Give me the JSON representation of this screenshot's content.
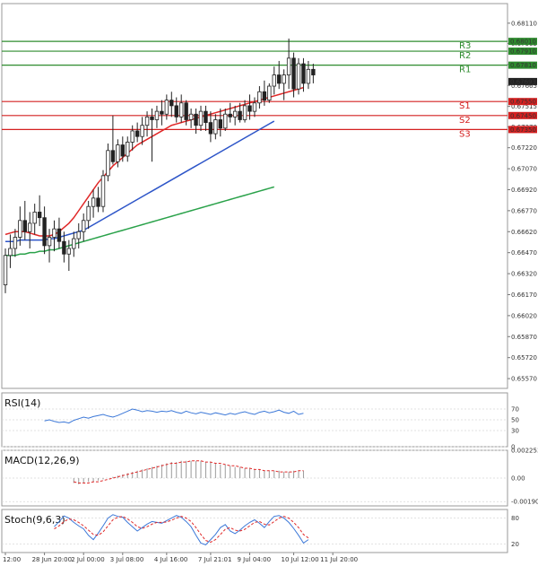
{
  "chart_data": {
    "type": "candlestick",
    "price_axis": {
      "min": 0.655,
      "max": 0.6825,
      "ticks": [
        "0.68110",
        "0.67965",
        "0.67815",
        "0.67665",
        "0.67515",
        "0.67370",
        "0.67220",
        "0.67070",
        "0.66920",
        "0.66770",
        "0.66620",
        "0.66470",
        "0.66320",
        "0.66170",
        "0.66020",
        "0.65870",
        "0.65720",
        "0.65570"
      ],
      "ticks_num": [
        0.6811,
        0.67965,
        0.67815,
        0.67665,
        0.67515,
        0.6737,
        0.6722,
        0.6707,
        0.6692,
        0.6677,
        0.6662,
        0.6647,
        0.6632,
        0.6617,
        0.6602,
        0.6587,
        0.6572,
        0.6557
      ]
    },
    "time_axis": {
      "labels": [
        "12:00",
        "28 Jun 20:00",
        "2 Jul 00:00",
        "3 Jul 08:00",
        "4 Jul 16:00",
        "7 Jul 21:01",
        "9 Jul 04:00",
        "10 Jul 12:00",
        "11 Jul 20:00"
      ],
      "label_bars": [
        0,
        8,
        16,
        24,
        33,
        42,
        50,
        59,
        67
      ]
    },
    "levels": [
      {
        "name": "R3",
        "value": 0.6798,
        "price_label": "0.68010",
        "color": "#2e8b2e"
      },
      {
        "name": "R2",
        "value": 0.6791,
        "price_label": "0.67910",
        "color": "#2e8b2e"
      },
      {
        "name": "R1",
        "value": 0.6781,
        "price_label": "0.67810",
        "color": "#2e8b2e"
      },
      {
        "name": "S1",
        "value": 0.6755,
        "price_label": "0.67550",
        "color": "#d42020"
      },
      {
        "name": "S2",
        "value": 0.6745,
        "price_label": "0.67450",
        "color": "#d42020"
      },
      {
        "name": "S3",
        "value": 0.6735,
        "price_label": "0.67350",
        "color": "#d42020"
      }
    ],
    "current_price": {
      "price_label": "0.67693",
      "value": 0.67693
    },
    "candles": [
      [
        0.6624,
        0.665,
        0.6618,
        0.6645
      ],
      [
        0.6645,
        0.666,
        0.6636,
        0.665
      ],
      [
        0.665,
        0.6664,
        0.6644,
        0.6658
      ],
      [
        0.6658,
        0.668,
        0.6652,
        0.667
      ],
      [
        0.667,
        0.6684,
        0.6656,
        0.6662
      ],
      [
        0.6662,
        0.6676,
        0.665,
        0.6668
      ],
      [
        0.6668,
        0.6682,
        0.666,
        0.6676
      ],
      [
        0.6676,
        0.6688,
        0.6666,
        0.6672
      ],
      [
        0.6672,
        0.668,
        0.6646,
        0.6652
      ],
      [
        0.6652,
        0.6664,
        0.664,
        0.6658
      ],
      [
        0.6658,
        0.667,
        0.6648,
        0.6664
      ],
      [
        0.6664,
        0.6672,
        0.665,
        0.6655
      ],
      [
        0.6655,
        0.6662,
        0.664,
        0.6646
      ],
      [
        0.6646,
        0.6656,
        0.6634,
        0.665
      ],
      [
        0.665,
        0.6662,
        0.6644,
        0.6657
      ],
      [
        0.6657,
        0.6668,
        0.665,
        0.6662
      ],
      [
        0.6662,
        0.6675,
        0.6655,
        0.667
      ],
      [
        0.667,
        0.6684,
        0.6664,
        0.668
      ],
      [
        0.668,
        0.6692,
        0.6672,
        0.6686
      ],
      [
        0.6686,
        0.6694,
        0.6676,
        0.668
      ],
      [
        0.668,
        0.6706,
        0.6676,
        0.6702
      ],
      [
        0.6702,
        0.6725,
        0.6698,
        0.672
      ],
      [
        0.672,
        0.6745,
        0.671,
        0.6712
      ],
      [
        0.6712,
        0.6728,
        0.6708,
        0.6724
      ],
      [
        0.6724,
        0.673,
        0.6712,
        0.6716
      ],
      [
        0.6716,
        0.673,
        0.6712,
        0.6726
      ],
      [
        0.6726,
        0.6738,
        0.672,
        0.6734
      ],
      [
        0.6734,
        0.674,
        0.6726,
        0.673
      ],
      [
        0.673,
        0.6744,
        0.6724,
        0.6738
      ],
      [
        0.6738,
        0.6748,
        0.673,
        0.6744
      ],
      [
        0.6744,
        0.675,
        0.6712,
        0.6742
      ],
      [
        0.6742,
        0.6752,
        0.6736,
        0.6748
      ],
      [
        0.6748,
        0.6756,
        0.6738,
        0.6746
      ],
      [
        0.6746,
        0.676,
        0.6742,
        0.6756
      ],
      [
        0.6756,
        0.6762,
        0.6744,
        0.6752
      ],
      [
        0.6752,
        0.6758,
        0.674,
        0.6744
      ],
      [
        0.6744,
        0.676,
        0.674,
        0.6754
      ],
      [
        0.6754,
        0.6756,
        0.6738,
        0.6742
      ],
      [
        0.6742,
        0.675,
        0.6736,
        0.6746
      ],
      [
        0.6746,
        0.675,
        0.6732,
        0.6738
      ],
      [
        0.6738,
        0.6752,
        0.6734,
        0.6748
      ],
      [
        0.6748,
        0.6752,
        0.6734,
        0.674
      ],
      [
        0.674,
        0.6748,
        0.6726,
        0.6732
      ],
      [
        0.6732,
        0.6746,
        0.6728,
        0.6742
      ],
      [
        0.6742,
        0.675,
        0.673,
        0.6736
      ],
      [
        0.6736,
        0.675,
        0.6734,
        0.6746
      ],
      [
        0.6746,
        0.6754,
        0.674,
        0.6744
      ],
      [
        0.6744,
        0.6752,
        0.6738,
        0.6748
      ],
      [
        0.6748,
        0.6754,
        0.674,
        0.6742
      ],
      [
        0.6742,
        0.6756,
        0.674,
        0.6752
      ],
      [
        0.6752,
        0.676,
        0.6742,
        0.6748
      ],
      [
        0.6748,
        0.6758,
        0.6744,
        0.6754
      ],
      [
        0.6754,
        0.6766,
        0.675,
        0.6762
      ],
      [
        0.6762,
        0.677,
        0.6752,
        0.6756
      ],
      [
        0.6756,
        0.6768,
        0.6754,
        0.6766
      ],
      [
        0.6766,
        0.678,
        0.676,
        0.6774
      ],
      [
        0.6774,
        0.6784,
        0.6764,
        0.6768
      ],
      [
        0.6768,
        0.6778,
        0.6756,
        0.6774
      ],
      [
        0.6774,
        0.68,
        0.6764,
        0.6786
      ],
      [
        0.6786,
        0.679,
        0.6758,
        0.6764
      ],
      [
        0.6764,
        0.6786,
        0.676,
        0.6782
      ],
      [
        0.6782,
        0.6786,
        0.6762,
        0.6768
      ],
      [
        0.6768,
        0.6784,
        0.6764,
        0.6778
      ],
      [
        0.6778,
        0.6782,
        0.6768,
        0.6774
      ]
    ],
    "ma_red": [
      0.666,
      0.6661,
      0.6662,
      0.6662,
      0.6662,
      0.6661,
      0.666,
      0.6659,
      0.6659,
      0.6659,
      0.666,
      0.6662,
      0.6665,
      0.6668,
      0.6672,
      0.6677,
      0.6682,
      0.6687,
      0.6692,
      0.6697,
      0.6701,
      0.6705,
      0.6709,
      0.6712,
      0.6715,
      0.6718,
      0.6721,
      0.6724,
      0.6726,
      0.6728,
      0.673,
      0.6732,
      0.6734,
      0.6736,
      0.6738,
      0.6739,
      0.674,
      0.6741,
      0.6742,
      0.6743,
      0.6744,
      0.6745,
      0.6746,
      0.6747,
      0.6748,
      0.6749,
      0.675,
      0.6751,
      0.6752,
      0.6753,
      0.6754,
      0.6755,
      0.6756,
      0.6757,
      0.6758,
      0.6759,
      0.676,
      0.6761,
      0.6762,
      0.6763,
      0.6764,
      0.6765
    ],
    "ma_blue": [
      0.6655,
      0.6655,
      0.6655,
      0.6656,
      0.6656,
      0.6656,
      0.6656,
      0.6656,
      0.6656,
      0.6657,
      0.6657,
      0.6658,
      0.6659,
      0.666,
      0.6661,
      0.6662,
      0.6663,
      0.6665,
      0.6667,
      0.6669,
      0.6671,
      0.6673,
      0.6675,
      0.6677,
      0.6679,
      0.6681,
      0.6683,
      0.6685,
      0.6687,
      0.6689,
      0.6691,
      0.6693,
      0.6695,
      0.6697,
      0.6699,
      0.6701,
      0.6703,
      0.6705,
      0.6707,
      0.6709,
      0.6711,
      0.6713,
      0.6715,
      0.6717,
      0.6719,
      0.6721,
      0.6723,
      0.6725,
      0.6727,
      0.6729,
      0.6731,
      0.6733,
      0.6735,
      0.6737,
      0.6739,
      0.6741
    ],
    "ma_green": [
      0.6645,
      0.6645,
      0.6645,
      0.6646,
      0.6646,
      0.6647,
      0.6647,
      0.6648,
      0.6648,
      0.6649,
      0.6649,
      0.665,
      0.6651,
      0.6652,
      0.6653,
      0.6654,
      0.6655,
      0.6656,
      0.6657,
      0.6658,
      0.6659,
      0.666,
      0.6661,
      0.6662,
      0.6663,
      0.6664,
      0.6665,
      0.6666,
      0.6667,
      0.6668,
      0.6669,
      0.667,
      0.6671,
      0.6672,
      0.6673,
      0.6674,
      0.6675,
      0.6676,
      0.6677,
      0.6678,
      0.6679,
      0.668,
      0.6681,
      0.6682,
      0.6683,
      0.6684,
      0.6685,
      0.6686,
      0.6687,
      0.6688,
      0.6689,
      0.669,
      0.6691,
      0.6692,
      0.6693,
      0.6694
    ],
    "indicators": [
      {
        "name": "RSI(14)",
        "ticks": [
          "70",
          "50",
          "30",
          "0"
        ],
        "ticks_num": [
          70,
          50,
          30,
          0
        ],
        "range": [
          0,
          100
        ],
        "values": [
          48,
          50,
          47,
          45,
          46,
          44,
          49,
          52,
          55,
          53,
          56,
          58,
          60,
          57,
          55,
          58,
          62,
          66,
          70,
          68,
          65,
          67,
          66,
          64,
          66,
          65,
          67,
          64,
          62,
          66,
          63,
          61,
          64,
          62,
          60,
          63,
          61,
          59,
          62,
          60,
          63,
          65,
          62,
          60,
          64,
          66,
          63,
          65,
          68,
          64,
          62,
          66,
          60,
          62
        ]
      },
      {
        "name": "MACD(12,26,9)",
        "ticks": [
          "0.002253",
          "0.00",
          "-0.001907"
        ],
        "ticks_num": [
          0.002253,
          0,
          -0.001907
        ],
        "range": [
          -0.002253,
          0.002253
        ],
        "hist": [
          -0.0004,
          -0.0005,
          -0.0004,
          -0.0003,
          -0.0003,
          -0.0002,
          -0.0001,
          0.0,
          0.0001,
          0.0002,
          0.0003,
          0.0004,
          0.0005,
          0.0006,
          0.0007,
          0.0008,
          0.0009,
          0.001,
          0.0011,
          0.0012,
          0.0013,
          0.0013,
          0.0014,
          0.0014,
          0.0014,
          0.0014,
          0.0014,
          0.0013,
          0.0013,
          0.0012,
          0.0011,
          0.0011,
          0.001,
          0.0009,
          0.0009,
          0.0008,
          0.0008,
          0.0007,
          0.0007,
          0.0006,
          0.0006,
          0.0006,
          0.0006,
          0.0005,
          0.0005,
          0.0006,
          0.0006,
          0.0006
        ],
        "signal": [
          -0.0003,
          -0.0004,
          -0.0004,
          -0.0004,
          -0.0003,
          -0.0003,
          -0.0002,
          -0.0001,
          0.0,
          0.0001,
          0.0002,
          0.0003,
          0.0004,
          0.0005,
          0.0006,
          0.0007,
          0.0008,
          0.0009,
          0.001,
          0.0011,
          0.0012,
          0.0012,
          0.0013,
          0.0013,
          0.0014,
          0.0014,
          0.0014,
          0.0013,
          0.0013,
          0.0012,
          0.0012,
          0.0011,
          0.001,
          0.001,
          0.0009,
          0.0008,
          0.0008,
          0.0007,
          0.0007,
          0.0006,
          0.0006,
          0.0006,
          0.0005,
          0.0005,
          0.0005,
          0.0005,
          0.0006,
          0.0006
        ]
      },
      {
        "name": "Stoch(9,6,3)",
        "ticks": [
          "80",
          "20"
        ],
        "ticks_num": [
          80,
          20
        ],
        "range": [
          0,
          100
        ],
        "main": [
          60,
          72,
          85,
          80,
          70,
          62,
          55,
          40,
          30,
          45,
          62,
          80,
          88,
          84,
          82,
          70,
          60,
          50,
          58,
          66,
          72,
          70,
          68,
          74,
          80,
          86,
          82,
          72,
          60,
          40,
          22,
          18,
          30,
          42,
          58,
          65,
          50,
          44,
          52,
          62,
          70,
          76,
          68,
          58,
          72,
          84,
          86,
          80,
          70,
          56,
          40,
          22,
          30
        ],
        "signal": [
          55,
          62,
          72,
          78,
          76,
          70,
          62,
          52,
          42,
          40,
          48,
          62,
          76,
          82,
          84,
          78,
          70,
          60,
          56,
          60,
          66,
          70,
          70,
          71,
          75,
          80,
          84,
          80,
          72,
          58,
          42,
          28,
          24,
          30,
          42,
          54,
          58,
          52,
          50,
          54,
          62,
          70,
          72,
          66,
          64,
          72,
          80,
          84,
          80,
          70,
          58,
          42,
          34
        ]
      }
    ]
  }
}
